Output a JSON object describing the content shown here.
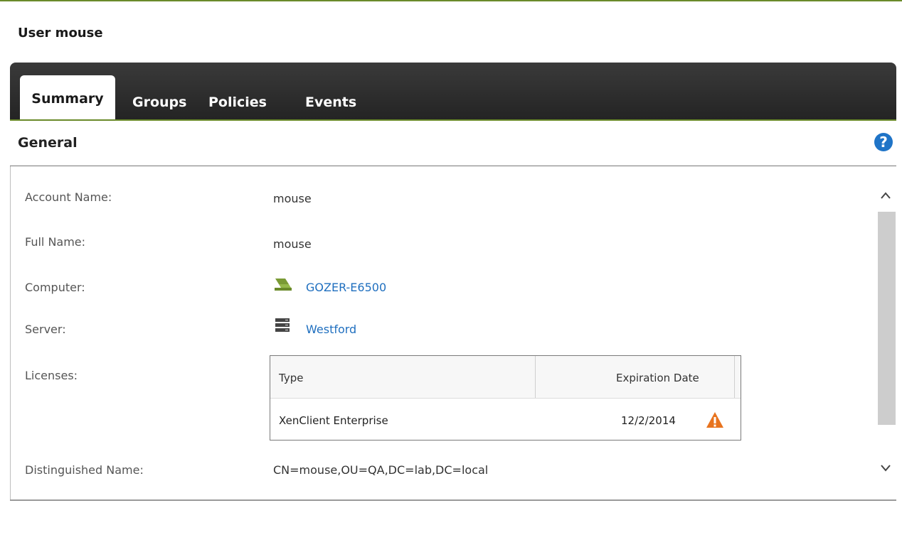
{
  "page": {
    "title": "User mouse"
  },
  "tabs": [
    {
      "label": "Summary",
      "active": true
    },
    {
      "label": "Groups"
    },
    {
      "label": "Policies"
    },
    {
      "label": "Events"
    }
  ],
  "section": {
    "title": "General",
    "help_icon": "?"
  },
  "fields": {
    "account_name": {
      "label": "Account Name:",
      "value": "mouse"
    },
    "full_name": {
      "label": "Full Name:",
      "value": "mouse"
    },
    "computer": {
      "label": "Computer:",
      "value": "GOZER-E6500",
      "icon": "laptop-icon"
    },
    "server": {
      "label": "Server:",
      "value": "Westford",
      "icon": "server-icon"
    },
    "licenses": {
      "label": "Licenses:"
    },
    "distinguished_name": {
      "label": "Distinguished Name:",
      "value": "CN=mouse,OU=QA,DC=lab,DC=local"
    }
  },
  "licenses_table": {
    "headers": [
      "Type",
      "Expiration Date"
    ],
    "rows": [
      {
        "type": "XenClient Enterprise",
        "expiration": "12/2/2014",
        "status_icon": "warning-icon"
      }
    ]
  },
  "colors": {
    "accent_green": "#6a8a2a",
    "link_blue": "#1f6fbf",
    "warning_orange": "#e8731e",
    "tabbar_dark": "#2a2a2a"
  }
}
